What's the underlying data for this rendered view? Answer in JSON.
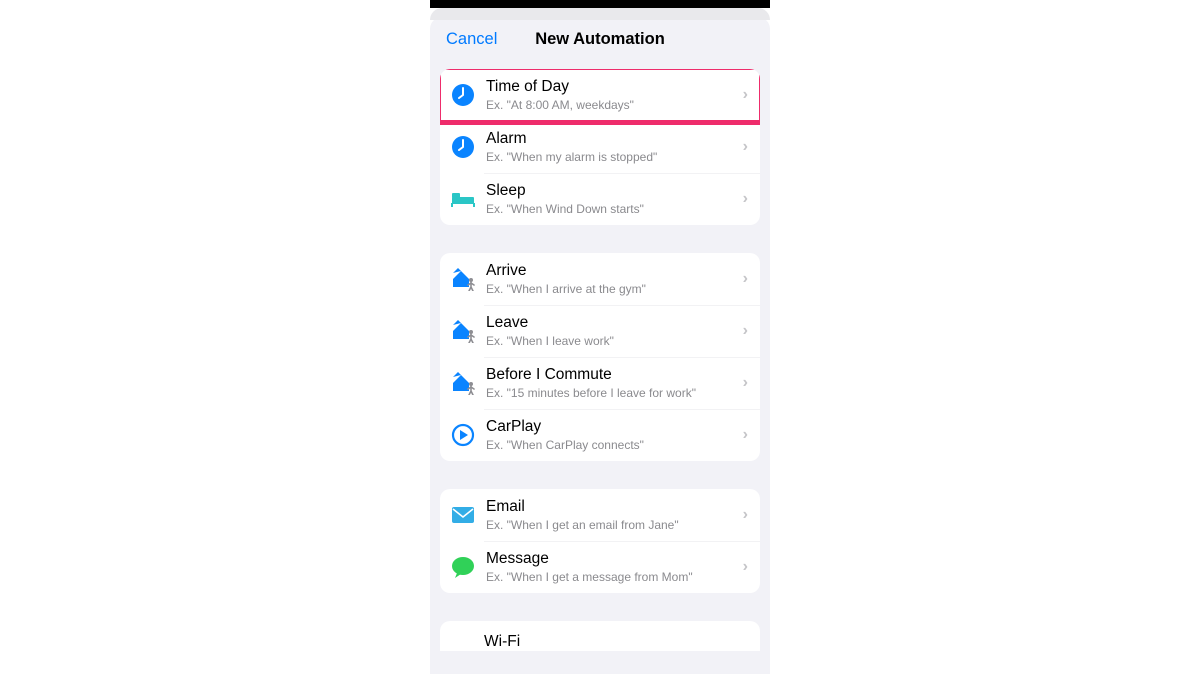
{
  "nav": {
    "cancel": "Cancel",
    "title": "New Automation"
  },
  "groups": [
    {
      "items": [
        {
          "icon": "clock-fill-icon",
          "title": "Time of Day",
          "subtitle": "Ex. \"At 8:00 AM, weekdays\"",
          "highlighted": true
        },
        {
          "icon": "clock-fill-icon",
          "title": "Alarm",
          "subtitle": "Ex. \"When my alarm is stopped\""
        },
        {
          "icon": "bed-icon",
          "title": "Sleep",
          "subtitle": "Ex. \"When Wind Down starts\""
        }
      ]
    },
    {
      "items": [
        {
          "icon": "house-person-icon",
          "title": "Arrive",
          "subtitle": "Ex. \"When I arrive at the gym\""
        },
        {
          "icon": "house-person-icon",
          "title": "Leave",
          "subtitle": "Ex. \"When I leave work\""
        },
        {
          "icon": "house-person-icon",
          "title": "Before I Commute",
          "subtitle": "Ex. \"15 minutes before I leave for work\""
        },
        {
          "icon": "carplay-icon",
          "title": "CarPlay",
          "subtitle": "Ex. \"When CarPlay connects\""
        }
      ]
    },
    {
      "items": [
        {
          "icon": "envelope-icon",
          "title": "Email",
          "subtitle": "Ex. \"When I get an email from Jane\""
        },
        {
          "icon": "message-bubble-icon",
          "title": "Message",
          "subtitle": "Ex. \"When I get a message from Mom\""
        }
      ]
    }
  ],
  "peek": {
    "title": "Wi-Fi"
  }
}
